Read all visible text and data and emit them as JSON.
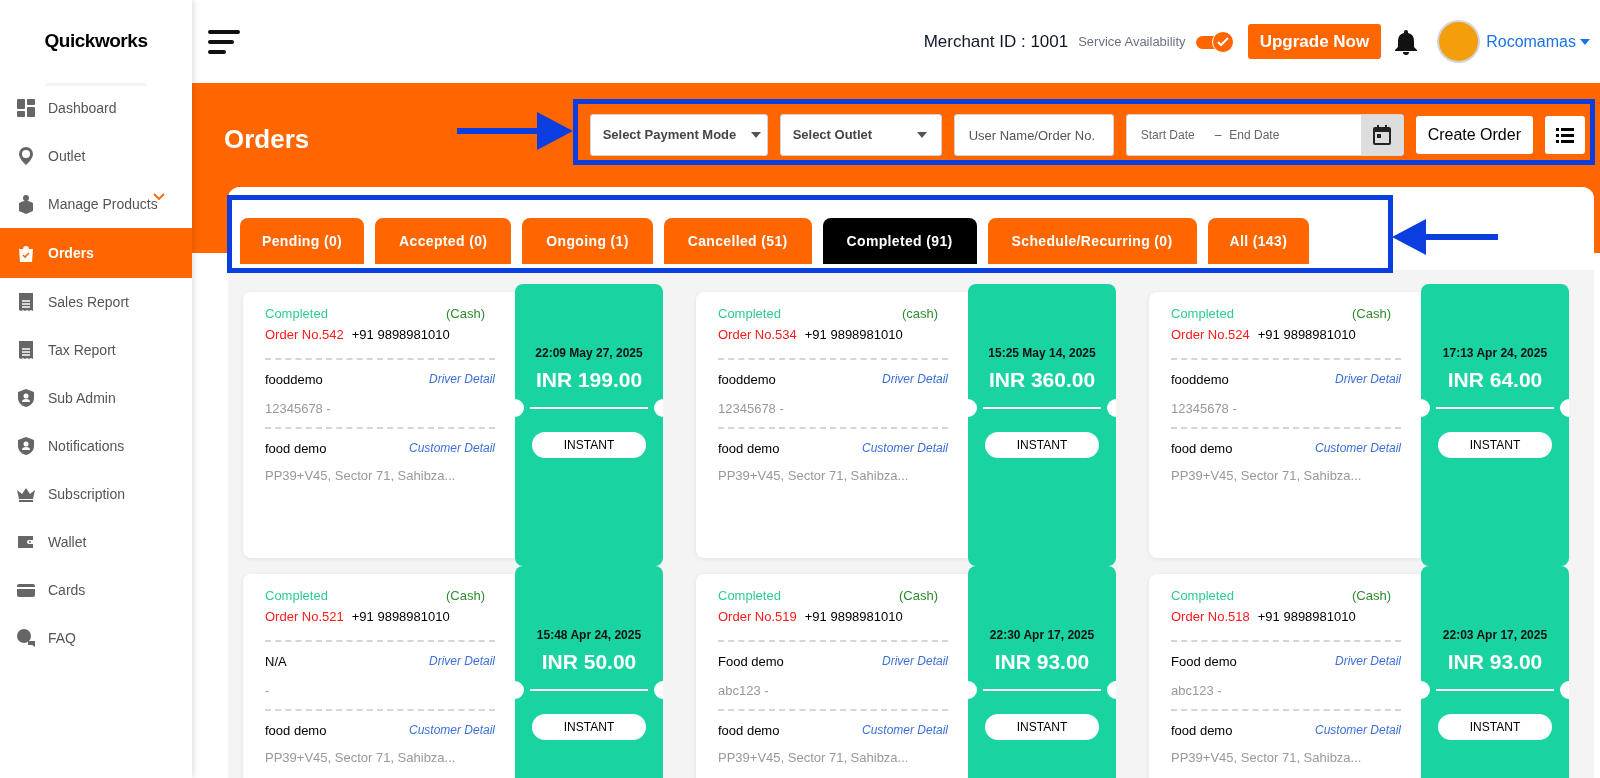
{
  "sidebar": {
    "logo": "Quickworks",
    "items": [
      {
        "label": "Dashboard",
        "selected": false,
        "has_submenu": false
      },
      {
        "label": "Outlet",
        "selected": false,
        "has_submenu": false
      },
      {
        "label": "Manage Products",
        "selected": false,
        "has_submenu": true
      },
      {
        "label": "Orders",
        "selected": true,
        "has_submenu": false
      },
      {
        "label": "Sales Report",
        "selected": false,
        "has_submenu": false
      },
      {
        "label": "Tax Report",
        "selected": false,
        "has_submenu": false
      },
      {
        "label": "Sub Admin",
        "selected": false,
        "has_submenu": false
      },
      {
        "label": "Notifications",
        "selected": false,
        "has_submenu": false
      },
      {
        "label": "Subscription",
        "selected": false,
        "has_submenu": false
      },
      {
        "label": "Wallet",
        "selected": false,
        "has_submenu": false
      },
      {
        "label": "Cards",
        "selected": false,
        "has_submenu": false
      },
      {
        "label": "FAQ",
        "selected": false,
        "has_submenu": false
      }
    ]
  },
  "header": {
    "merchant_id": "Merchant ID : 1001",
    "service_label": "Service Availability",
    "service_on": true,
    "upgrade_button": "Upgrade Now",
    "user_name": "Rocomamas"
  },
  "page_title": "Orders",
  "filters": {
    "payment_mode": {
      "placeholder": "Select Payment Mode"
    },
    "outlet": {
      "placeholder": "Select Outlet"
    },
    "search": {
      "placeholder": "User Name/Order No."
    },
    "start_date": {
      "placeholder": "Start Date"
    },
    "date_separator": "–",
    "end_date": {
      "placeholder": "End Date"
    },
    "create_button": "Create Order"
  },
  "tabs": [
    {
      "label": "Pending (0)",
      "selected": false
    },
    {
      "label": "Accepted (0)",
      "selected": false
    },
    {
      "label": "Ongoing (1)",
      "selected": false
    },
    {
      "label": "Cancelled (51)",
      "selected": false
    },
    {
      "label": "Completed (91)",
      "selected": true
    },
    {
      "label": "Schedule/Recurring (0)",
      "selected": false
    },
    {
      "label": "All (143)",
      "selected": false
    }
  ],
  "orders": [
    {
      "status": "Completed",
      "payment": "(Cash)",
      "order_no": "Order No.542",
      "phone": "+91 9898981010",
      "driver_name": "fooddemo",
      "driver_link": "Driver Detail",
      "driver_info": "12345678 -",
      "customer_name": "food demo",
      "customer_link": "Customer Detail",
      "address": "PP39+V45, Sector 71, Sahibza...",
      "datetime": "22:09 May 27, 2025",
      "amount": "INR 199.00",
      "type": "INSTANT"
    },
    {
      "status": "Completed",
      "payment": "(cash)",
      "order_no": "Order No.534",
      "phone": "+91 9898981010",
      "driver_name": "fooddemo",
      "driver_link": "Driver Detail",
      "driver_info": "12345678 -",
      "customer_name": "food demo",
      "customer_link": "Customer Detail",
      "address": "PP39+V45, Sector 71, Sahibza...",
      "datetime": "15:25 May 14, 2025",
      "amount": "INR 360.00",
      "type": "INSTANT"
    },
    {
      "status": "Completed",
      "payment": "(Cash)",
      "order_no": "Order No.524",
      "phone": "+91 9898981010",
      "driver_name": "fooddemo",
      "driver_link": "Driver Detail",
      "driver_info": "12345678 -",
      "customer_name": "food demo",
      "customer_link": "Customer Detail",
      "address": "PP39+V45, Sector 71, Sahibza...",
      "datetime": "17:13 Apr 24, 2025",
      "amount": "INR 64.00",
      "type": "INSTANT"
    },
    {
      "status": "Completed",
      "payment": "(Cash)",
      "order_no": "Order No.521",
      "phone": "+91 9898981010",
      "driver_name": "N/A",
      "driver_link": "Driver Detail",
      "driver_info": "-",
      "customer_name": "food demo",
      "customer_link": "Customer Detail",
      "address": "PP39+V45, Sector 71, Sahibza...",
      "datetime": "15:48 Apr 24, 2025",
      "amount": "INR 50.00",
      "type": "INSTANT"
    },
    {
      "status": "Completed",
      "payment": "(Cash)",
      "order_no": "Order No.519",
      "phone": "+91 9898981010",
      "driver_name": "Food demo",
      "driver_link": "Driver Detail",
      "driver_info": "abc123 -",
      "customer_name": "food demo",
      "customer_link": "Customer Detail",
      "address": "PP39+V45, Sector 71, Sahibza...",
      "datetime": "22:30 Apr 17, 2025",
      "amount": "INR 93.00",
      "type": "INSTANT"
    },
    {
      "status": "Completed",
      "payment": "(Cash)",
      "order_no": "Order No.518",
      "phone": "+91 9898981010",
      "driver_name": "Food demo",
      "driver_link": "Driver Detail",
      "driver_info": "abc123 -",
      "customer_name": "food demo",
      "customer_link": "Customer Detail",
      "address": "PP39+V45, Sector 71, Sahibza...",
      "datetime": "22:03 Apr 17, 2025",
      "amount": "INR 93.00",
      "type": "INSTANT"
    }
  ]
}
